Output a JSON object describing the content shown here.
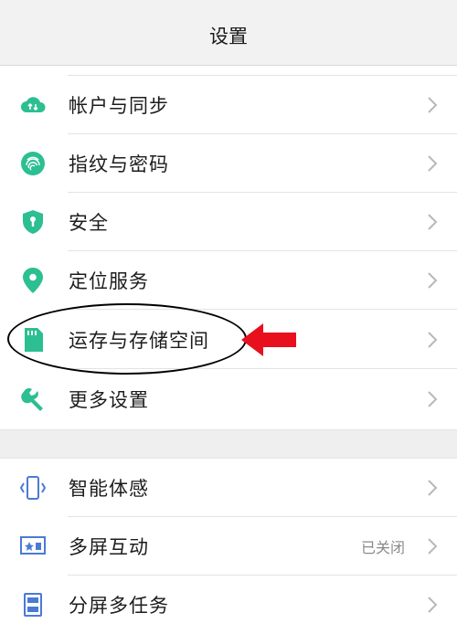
{
  "header": {
    "title": "设置"
  },
  "section1": [
    {
      "label": "帐户与同步",
      "icon": "cloud-sync-icon"
    },
    {
      "label": "指纹与密码",
      "icon": "fingerprint-icon"
    },
    {
      "label": "安全",
      "icon": "shield-icon"
    },
    {
      "label": "定位服务",
      "icon": "location-pin-icon"
    },
    {
      "label": "运存与存储空间",
      "icon": "sd-card-icon"
    },
    {
      "label": "更多设置",
      "icon": "wrench-icon"
    }
  ],
  "section2": [
    {
      "label": "智能体感",
      "icon": "phone-motion-icon"
    },
    {
      "label": "多屏互动",
      "icon": "screen-cast-icon",
      "status": "已关闭"
    },
    {
      "label": "分屏多任务",
      "icon": "split-screen-icon"
    }
  ],
  "colors": {
    "green_icon": "#2bbf91",
    "blue_icon": "#4a7ad6",
    "highlight_arrow": "#e8101c",
    "chevron": "#b8b8b8"
  }
}
